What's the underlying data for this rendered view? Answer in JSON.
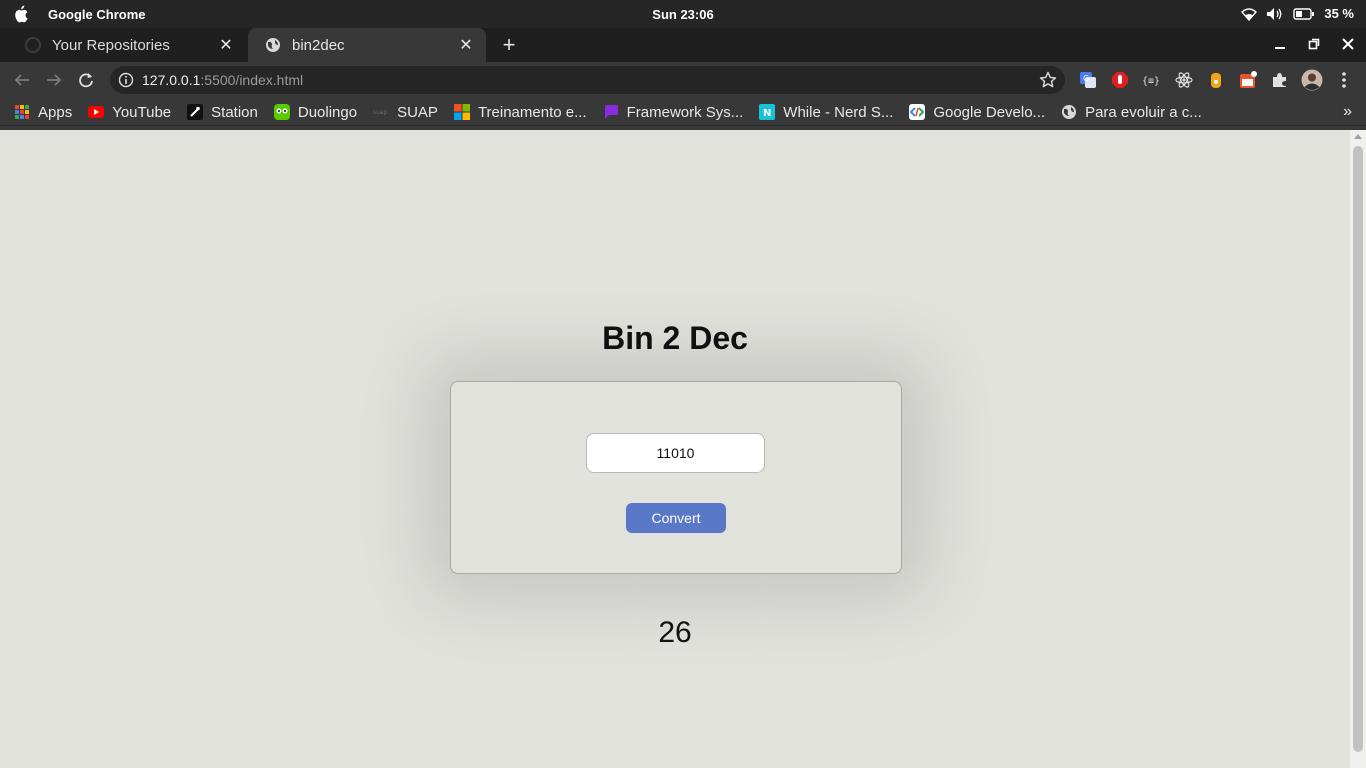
{
  "os_bar": {
    "app_name": "Google Chrome",
    "clock": "Sun 23:06",
    "battery": "35 %"
  },
  "tabs": [
    {
      "title": "Your Repositories",
      "icon": "github-icon",
      "active": false
    },
    {
      "title": "bin2dec",
      "icon": "globe-icon",
      "active": true
    }
  ],
  "toolbar": {
    "url_host": "127.0.0.1",
    "url_rest": ":5500/index.html"
  },
  "bookmarks": [
    {
      "label": "Apps",
      "icon": "apps-grid-icon"
    },
    {
      "label": "YouTube",
      "icon": "youtube-icon"
    },
    {
      "label": "Station",
      "icon": "station-icon"
    },
    {
      "label": "Duolingo",
      "icon": "duolingo-icon"
    },
    {
      "label": "SUAP",
      "icon": "suap-icon"
    },
    {
      "label": "Treinamento e...",
      "icon": "microsoft-icon"
    },
    {
      "label": "Framework Sys...",
      "icon": "chat-bubble-icon"
    },
    {
      "label": "While - Nerd S...",
      "icon": "notion-icon"
    },
    {
      "label": "Google Develo...",
      "icon": "google-developers-icon"
    },
    {
      "label": "Para evoluir a c...",
      "icon": "globe-icon"
    }
  ],
  "colors": {
    "page_bg": "#e2e2dd",
    "button_bg": "#5a78c8",
    "chrome_dark": "#383838"
  },
  "app": {
    "title": "Bin 2 Dec",
    "input_value": "11010",
    "button_label": "Convert",
    "result": "26"
  }
}
